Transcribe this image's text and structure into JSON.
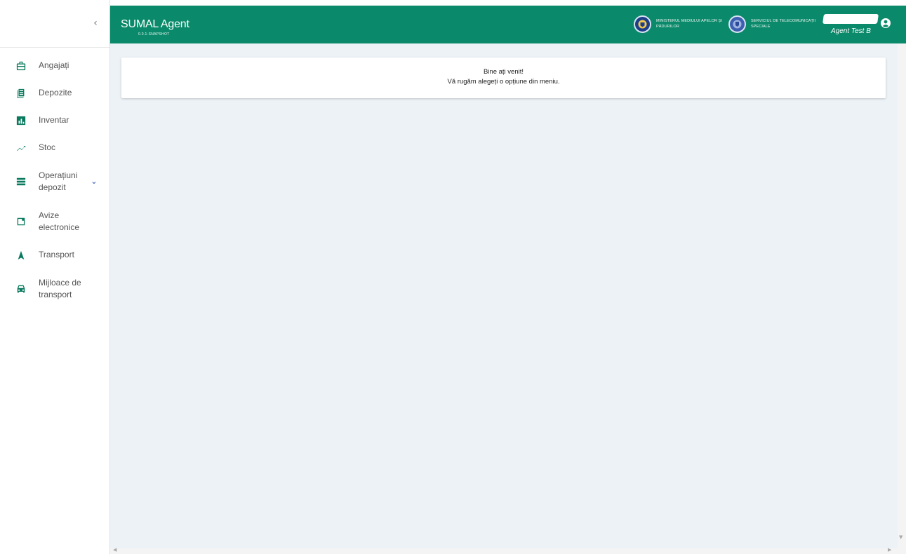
{
  "sidebar": {
    "collapse_glyph": "‹",
    "items": [
      {
        "label": "Angajați",
        "icon": "briefcase-icon"
      },
      {
        "label": "Depozite",
        "icon": "documents-icon"
      },
      {
        "label": "Inventar",
        "icon": "bar-chart-icon"
      },
      {
        "label": "Stoc",
        "icon": "trending-up-icon"
      },
      {
        "label": "Operațiuni depozit",
        "icon": "list-icon",
        "expandable": true
      },
      {
        "label": "Avize electronice",
        "icon": "note-icon"
      },
      {
        "label": "Transport",
        "icon": "navigation-arrow-icon"
      },
      {
        "label": "Mijloace de transport",
        "icon": "car-icon"
      }
    ],
    "chevron_glyph": "⌄"
  },
  "header": {
    "title": "SUMAL Agent",
    "version": "0.0.1-SNAPSHOT",
    "org1": "MINISTERUL MEDIULUI APELOR ȘI PĂDURILOR",
    "org2": "SERVICIUL DE TELECOMUNICAȚII SPECIALE",
    "user_name": "Agent Test B",
    "brand_color": "#0a8a6a"
  },
  "main": {
    "welcome_line1": "Bine ați venit!",
    "welcome_line2": "Vă rugăm alegeți o opțiune din meniu."
  }
}
